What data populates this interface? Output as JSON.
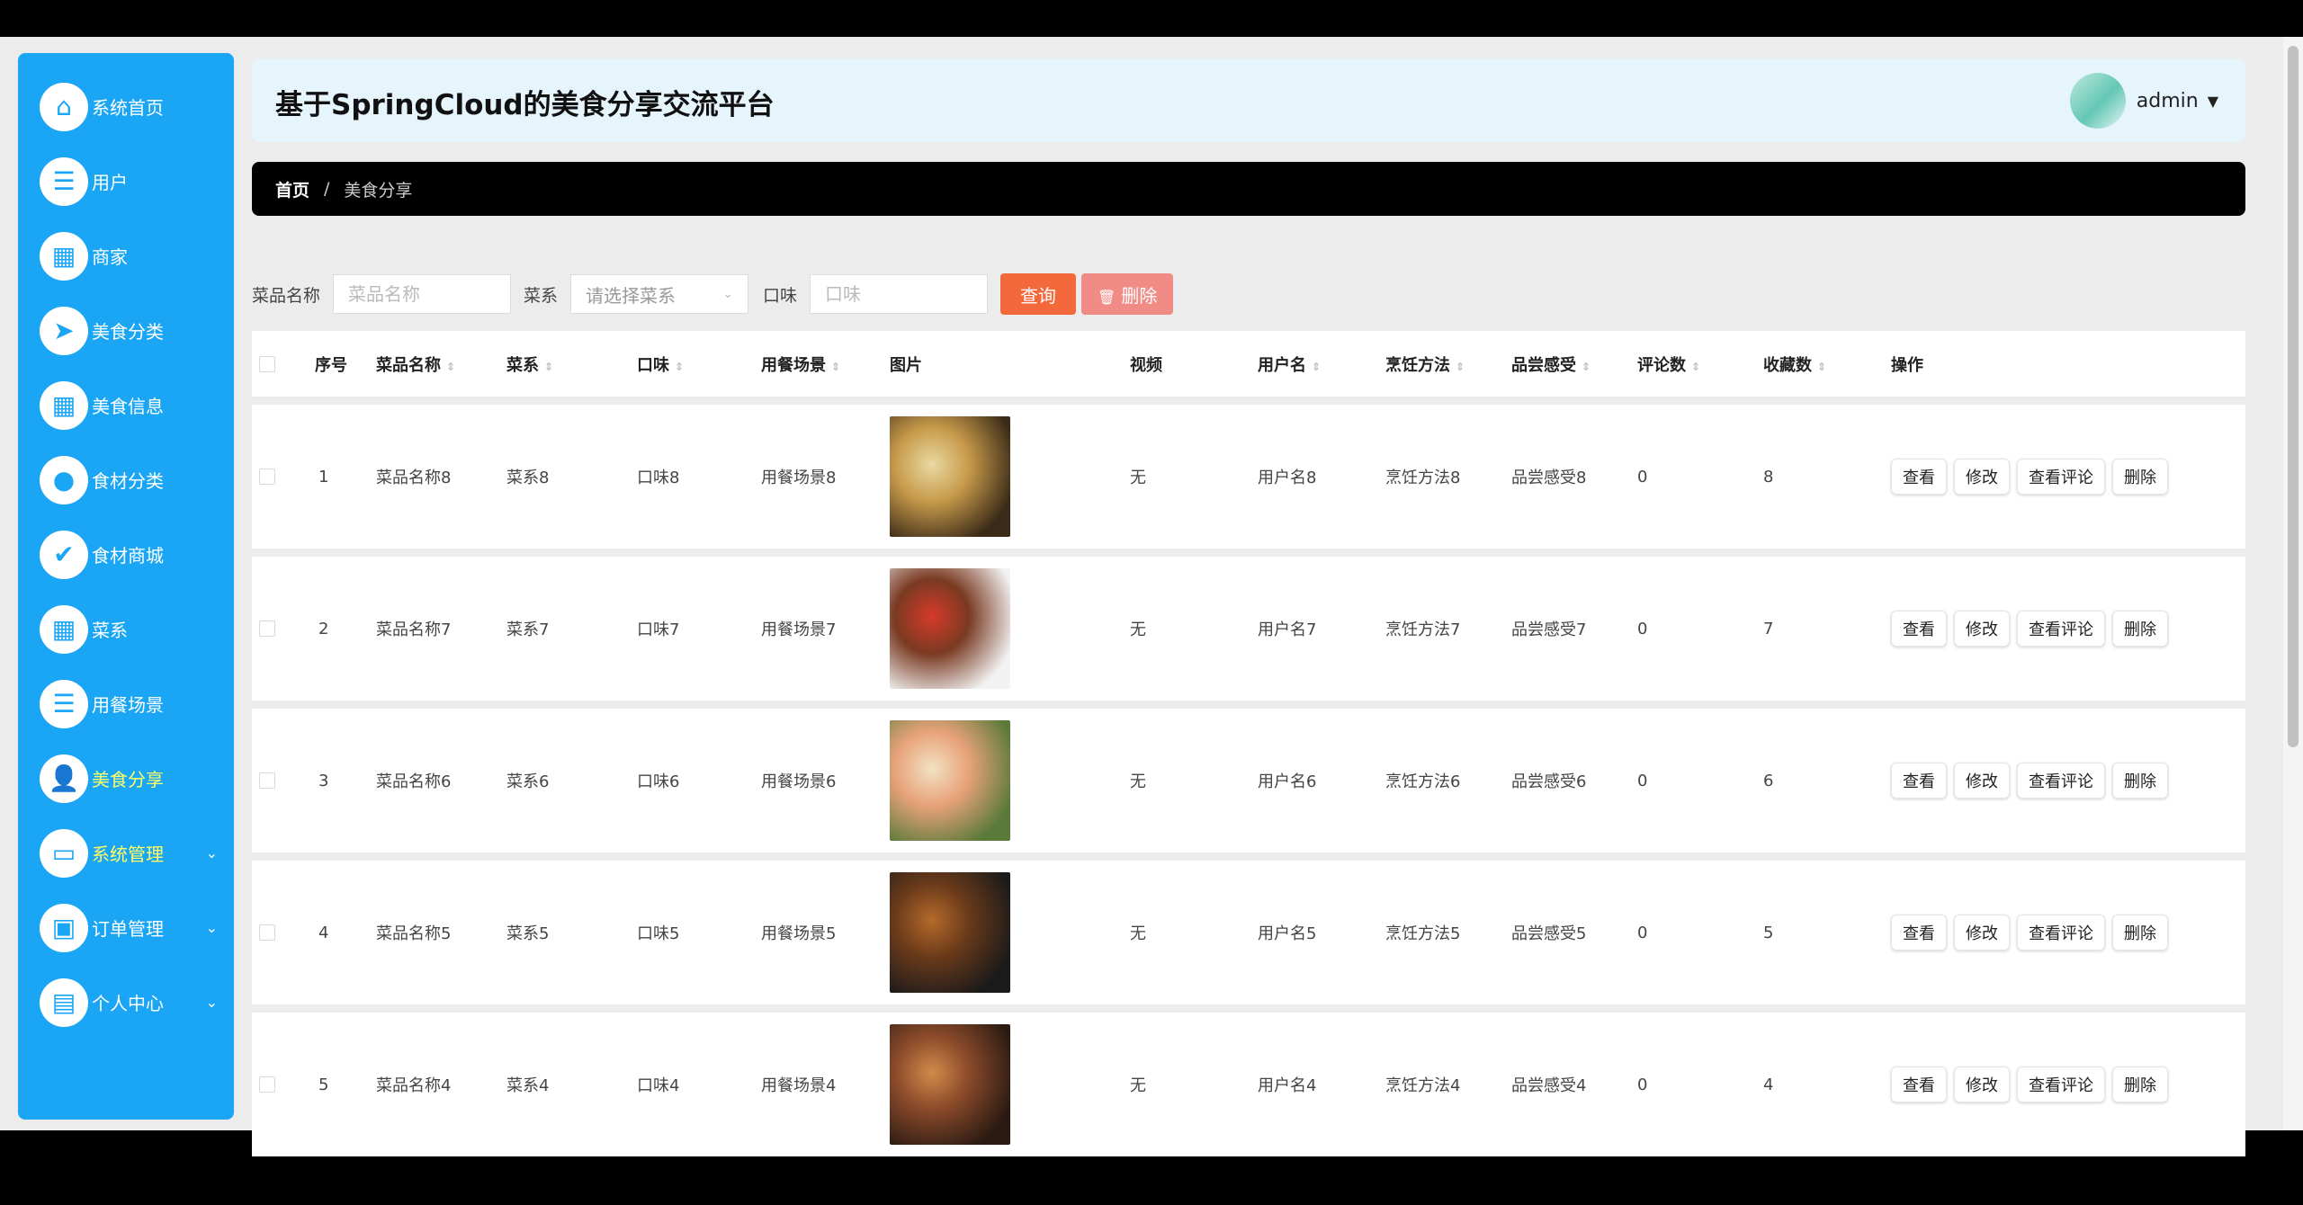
{
  "app": {
    "title": "基于SpringCloud的美食分享交流平台",
    "user": "admin"
  },
  "sidebar": {
    "items": [
      {
        "label": "系统首页",
        "icon": "home-icon",
        "glyph": "⌂"
      },
      {
        "label": "用户",
        "icon": "sliders-icon",
        "glyph": "☰"
      },
      {
        "label": "商家",
        "icon": "grid-icon",
        "glyph": "▦"
      },
      {
        "label": "美食分类",
        "icon": "send-icon",
        "glyph": "➤"
      },
      {
        "label": "美食信息",
        "icon": "grid-icon",
        "glyph": "▦"
      },
      {
        "label": "食材分类",
        "icon": "balloon-icon",
        "glyph": "●"
      },
      {
        "label": "食材商城",
        "icon": "clipboard-check-icon",
        "glyph": "✔"
      },
      {
        "label": "菜系",
        "icon": "grid-icon",
        "glyph": "▦"
      },
      {
        "label": "用餐场景",
        "icon": "list-icon",
        "glyph": "☰"
      },
      {
        "label": "美食分享",
        "icon": "user-icon",
        "glyph": "👤"
      },
      {
        "label": "系统管理",
        "icon": "monitor-icon",
        "glyph": "▭"
      },
      {
        "label": "订单管理",
        "icon": "wallet-icon",
        "glyph": "▣"
      },
      {
        "label": "个人中心",
        "icon": "card-icon",
        "glyph": "▤"
      }
    ]
  },
  "breadcrumb": {
    "home": "首页",
    "sep": "/",
    "current": "美食分享"
  },
  "search": {
    "name_label": "菜品名称",
    "name_placeholder": "菜品名称",
    "cuisine_label": "菜系",
    "cuisine_placeholder": "请选择菜系",
    "taste_label": "口味",
    "taste_placeholder": "口味",
    "query": "查询",
    "delete": "删除"
  },
  "table": {
    "headers": [
      "序号",
      "菜品名称",
      "菜系",
      "口味",
      "用餐场景",
      "图片",
      "视频",
      "用户名",
      "烹饪方法",
      "品尝感受",
      "评论数",
      "收藏数",
      "操作"
    ],
    "rows": [
      {
        "idx": "1",
        "name": "菜品名称8",
        "cuisine": "菜系8",
        "taste": "口味8",
        "scene": "用餐场景8",
        "video": "无",
        "user": "用户名8",
        "method": "烹饪方法8",
        "feeling": "品尝感受8",
        "comments": "0",
        "favorites": "8",
        "img_colors": [
          "#3a2a18",
          "#c79a4a",
          "#e9d9a2"
        ]
      },
      {
        "idx": "2",
        "name": "菜品名称7",
        "cuisine": "菜系7",
        "taste": "口味7",
        "scene": "用餐场景7",
        "video": "无",
        "user": "用户名7",
        "method": "烹饪方法7",
        "feeling": "品尝感受7",
        "comments": "0",
        "favorites": "7",
        "img_colors": [
          "#f2f2f2",
          "#7a3a22",
          "#d63a2a"
        ]
      },
      {
        "idx": "3",
        "name": "菜品名称6",
        "cuisine": "菜系6",
        "taste": "口味6",
        "scene": "用餐场景6",
        "video": "无",
        "user": "用户名6",
        "method": "烹饪方法6",
        "feeling": "品尝感受6",
        "comments": "0",
        "favorites": "6",
        "img_colors": [
          "#5a7a3a",
          "#e8a27a",
          "#f2e2c2"
        ]
      },
      {
        "idx": "4",
        "name": "菜品名称5",
        "cuisine": "菜系5",
        "taste": "口味5",
        "scene": "用餐场景5",
        "video": "无",
        "user": "用户名5",
        "method": "烹饪方法5",
        "feeling": "品尝感受5",
        "comments": "0",
        "favorites": "5",
        "img_colors": [
          "#1a1a1a",
          "#6a3a1a",
          "#b56a2a"
        ]
      },
      {
        "idx": "5",
        "name": "菜品名称4",
        "cuisine": "菜系4",
        "taste": "口味4",
        "scene": "用餐场景4",
        "video": "无",
        "user": "用户名4",
        "method": "烹饪方法4",
        "feeling": "品尝感受4",
        "comments": "0",
        "favorites": "4",
        "img_colors": [
          "#2a1a12",
          "#8a4a2a",
          "#d28a4a"
        ]
      }
    ],
    "ops": [
      "查看",
      "修改",
      "查看评论",
      "删除"
    ]
  }
}
